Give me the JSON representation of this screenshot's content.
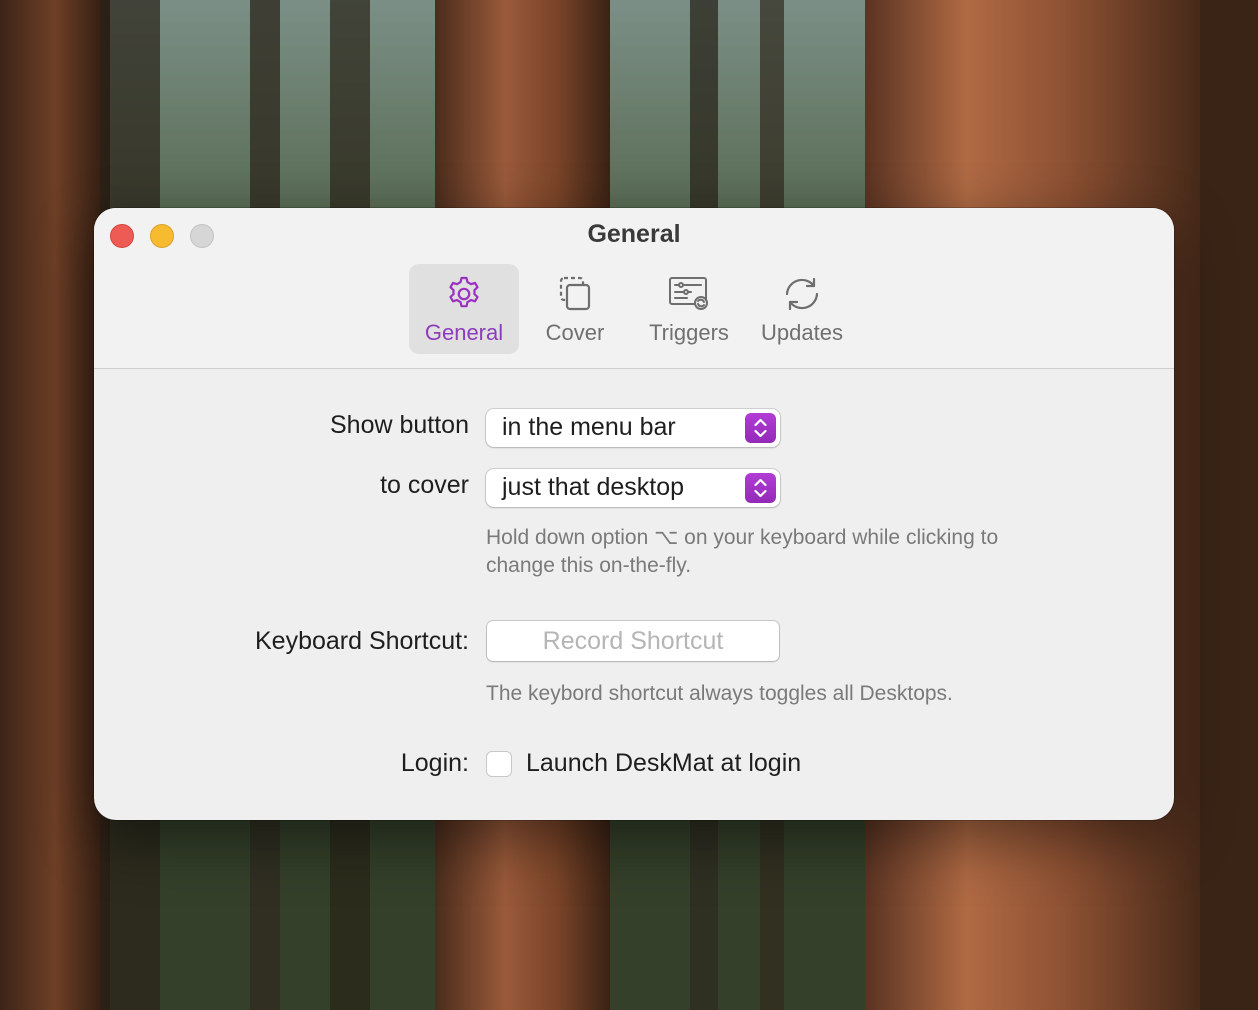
{
  "window": {
    "title": "General"
  },
  "tabs": [
    {
      "label": "General",
      "icon": "gear-icon",
      "active": true
    },
    {
      "label": "Cover",
      "icon": "cover-icon",
      "active": false
    },
    {
      "label": "Triggers",
      "icon": "triggers-icon",
      "active": false
    },
    {
      "label": "Updates",
      "icon": "updates-icon",
      "active": false
    }
  ],
  "settings": {
    "show_button_label": "Show button",
    "show_button_value": "in the menu bar",
    "cover_label": "to cover",
    "cover_value": "just that desktop",
    "option_hint_line1": "Hold down option ⌥ on your keyboard while clicking to",
    "option_hint_line2": "change this on-the-fly.",
    "shortcut_label": "Keyboard Shortcut:",
    "shortcut_button": "Record Shortcut",
    "shortcut_hint": "The keybord shortcut always toggles all Desktops.",
    "login_label": "Login:",
    "login_checkbox_label": "Launch DeskMat at login",
    "login_checked": false
  },
  "colors": {
    "accent": "#9b30c2",
    "close": "#ee5b55",
    "minimize": "#f6bb2f",
    "zoom_disabled": "#d6d6d6"
  }
}
